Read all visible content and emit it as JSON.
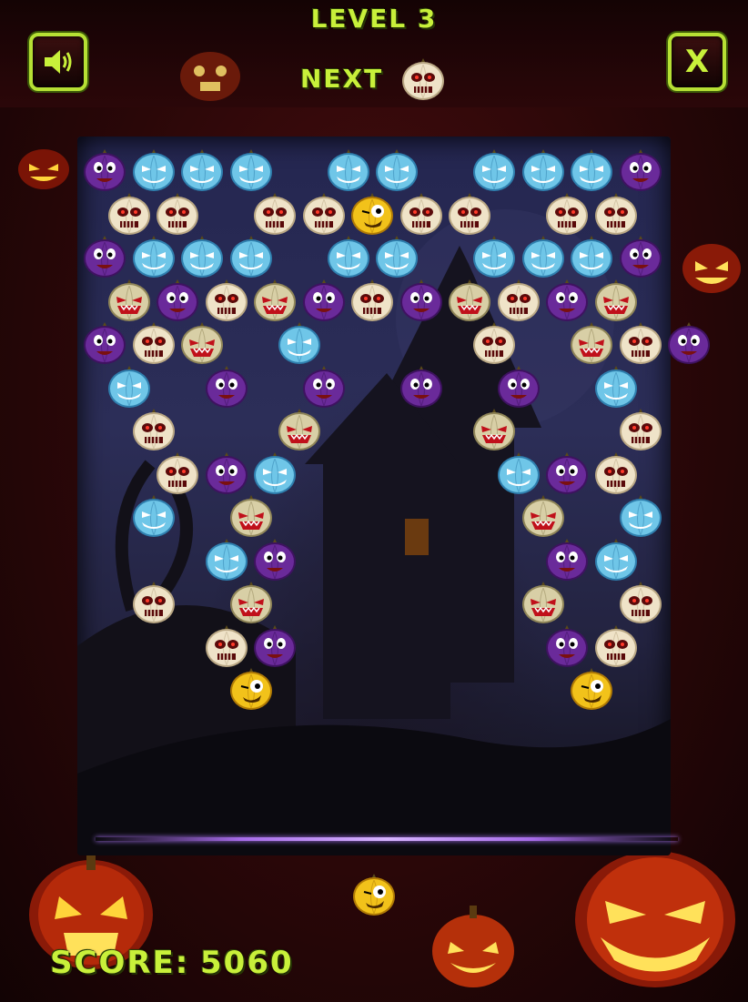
{
  "hud": {
    "level_label": "LEVEL 3",
    "next_label": "NEXT",
    "score_label": "SCORE:",
    "score_value": "5060",
    "sound_icon": "speaker-icon",
    "close_label": "X"
  },
  "colors": {
    "hud_text": "#c8f03a",
    "purple": "#6a2a9a",
    "blue": "#6fc6e8",
    "cream": "#efe3c8",
    "tan": "#d8cfa6",
    "yellow": "#f2c21a"
  },
  "next_bubble": "cream",
  "shooter_bubble": "yellow",
  "bubble_rows": [
    [
      "purple",
      "blue",
      "blue",
      "blue",
      "",
      "blue",
      "blue",
      "",
      "blue",
      "blue",
      "blue",
      "purple"
    ],
    [
      "cream",
      "cream",
      "",
      "cream",
      "cream",
      "yellow",
      "cream",
      "cream",
      "",
      "cream",
      "cream"
    ],
    [
      "purple",
      "blue",
      "blue",
      "blue",
      "",
      "blue",
      "blue",
      "",
      "blue",
      "blue",
      "blue",
      "purple"
    ],
    [
      "tan",
      "purple",
      "cream",
      "tan",
      "purple",
      "cream",
      "purple",
      "tan",
      "cream",
      "purple",
      "tan"
    ],
    [
      "purple",
      "cream",
      "tan",
      "",
      "blue",
      "",
      "",
      "",
      "cream",
      "",
      "tan",
      "cream",
      "purple"
    ],
    [
      "blue",
      "",
      "purple",
      "",
      "purple",
      "",
      "purple",
      "",
      "purple",
      "",
      "blue"
    ],
    [
      "",
      "cream",
      "",
      "",
      "tan",
      "",
      "",
      "",
      "tan",
      "",
      "",
      "cream"
    ],
    [
      "",
      "cream",
      "purple",
      "blue",
      "",
      "",
      "",
      "",
      "blue",
      "purple",
      "cream"
    ],
    [
      "",
      "blue",
      "",
      "tan",
      "",
      "",
      "",
      "",
      "",
      "tan",
      "",
      "blue"
    ],
    [
      "",
      "",
      "blue",
      "purple",
      "",
      "",
      "",
      "",
      "",
      "purple",
      "blue"
    ],
    [
      "",
      "cream",
      "",
      "tan",
      "",
      "",
      "",
      "",
      "",
      "tan",
      "",
      "cream"
    ],
    [
      "",
      "",
      "cream",
      "purple",
      "",
      "",
      "",
      "",
      "",
      "purple",
      "cream"
    ],
    [
      "",
      "",
      "",
      "yellow",
      "",
      "",
      "",
      "",
      "",
      "",
      "yellow"
    ]
  ]
}
